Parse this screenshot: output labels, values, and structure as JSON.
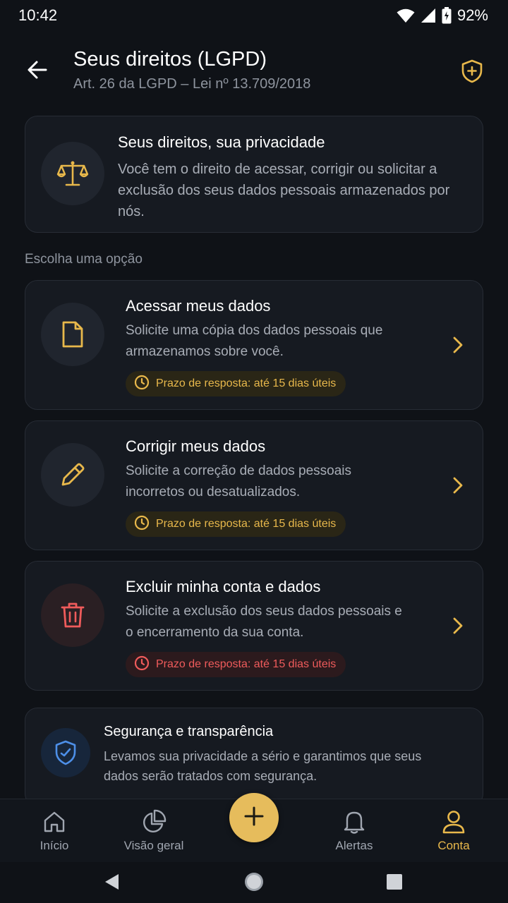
{
  "status_bar": {
    "time": "10:42",
    "battery": "92%"
  },
  "header": {
    "title": "Seus direitos (LGPD)",
    "subtitle": "Art. 26 da LGPD – Lei nº 13.709/2018",
    "back_icon": "arrow-left-icon",
    "shield_icon": "shield-plus-icon"
  },
  "intro": {
    "icon": "scale-icon",
    "title": "Seus direitos, sua privacidade",
    "text": "Você tem o direito de acessar, corrigir ou solicitar a exclusão dos seus dados pessoais armazenados por nós."
  },
  "section_label": "Escolha uma opção",
  "options": [
    {
      "icon": "document-icon",
      "title": "Acessar meus dados",
      "text": "Solicite uma cópia dos dados pessoais que armazenamos sobre você.",
      "badge": "Prazo de resposta: até 15 dias úteis"
    },
    {
      "icon": "pencil-icon",
      "title": "Corrigir meus dados",
      "text": "Solicite a correção de dados pessoais incorretos ou desatualizados.",
      "badge": "Prazo de resposta: até 15 dias úteis"
    },
    {
      "icon": "trash-icon",
      "title": "Excluir minha conta e dados",
      "text": "Solicite a exclusão dos seus dados pessoais e o encerramento da sua conta.",
      "badge": "Prazo de resposta: até 15 dias úteis"
    }
  ],
  "security": {
    "icon": "shield-check-icon",
    "title": "Segurança e transparência",
    "text": "Levamos sua privacidade a sério e garantimos que seus dados serão tratados com segurança."
  },
  "bottom_nav": [
    {
      "label": "Início",
      "icon": "home-icon"
    },
    {
      "label": "Visão geral",
      "icon": "pie-chart-icon"
    },
    {
      "label": "Alertas",
      "icon": "bell-icon"
    },
    {
      "label": "Conta",
      "icon": "user-icon",
      "active": true
    }
  ],
  "fab_icon": "plus-icon",
  "colors": {
    "accent": "#e8b84b",
    "danger": "#ef5b5b",
    "info": "#4d8fe8",
    "background": "#0f1217",
    "card": "#161a21"
  }
}
